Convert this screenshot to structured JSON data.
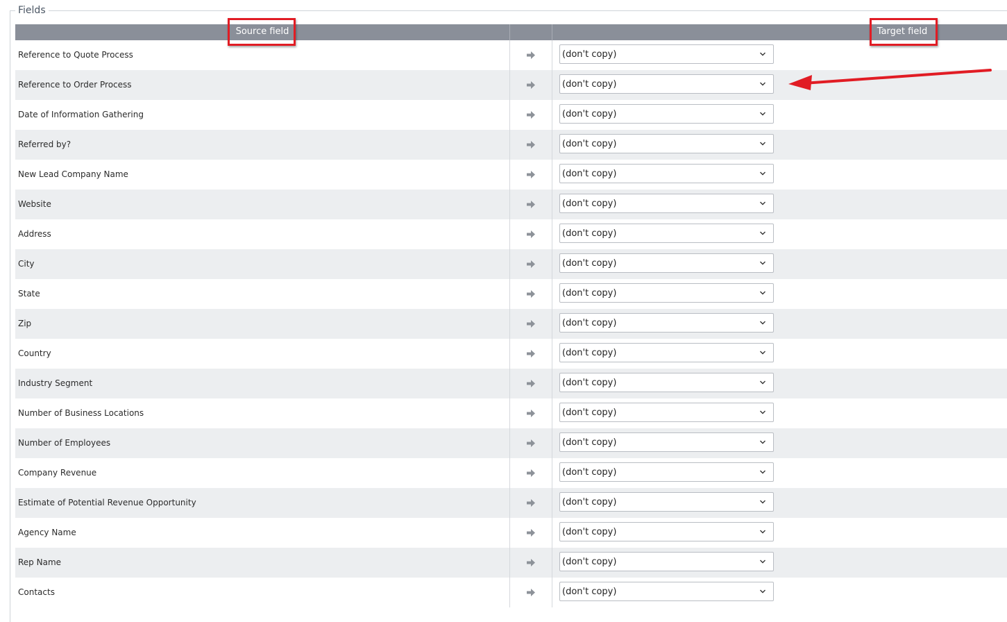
{
  "section": {
    "legend": "Fields"
  },
  "table": {
    "source_header": "Source field",
    "target_header": "Target field",
    "rows": [
      {
        "source": "Reference to Quote Process",
        "target": "(don't copy)"
      },
      {
        "source": "Reference to Order Process",
        "target": "(don't copy)"
      },
      {
        "source": "Date of Information Gathering",
        "target": "(don't copy)"
      },
      {
        "source": "Referred by?",
        "target": "(don't copy)"
      },
      {
        "source": "New Lead Company Name",
        "target": "(don't copy)"
      },
      {
        "source": "Website",
        "target": "(don't copy)"
      },
      {
        "source": "Address",
        "target": "(don't copy)"
      },
      {
        "source": "City",
        "target": "(don't copy)"
      },
      {
        "source": "State",
        "target": "(don't copy)"
      },
      {
        "source": "Zip",
        "target": "(don't copy)"
      },
      {
        "source": "Country",
        "target": "(don't copy)"
      },
      {
        "source": "Industry Segment",
        "target": "(don't copy)"
      },
      {
        "source": "Number of Business Locations",
        "target": "(don't copy)"
      },
      {
        "source": "Number of Employees",
        "target": "(don't copy)"
      },
      {
        "source": "Company Revenue",
        "target": "(don't copy)"
      },
      {
        "source": "Estimate of Potential Revenue Opportunity",
        "target": "(don't copy)"
      },
      {
        "source": "Agency Name",
        "target": "(don't copy)"
      },
      {
        "source": "Rep Name",
        "target": "(don't copy)"
      },
      {
        "source": "Contacts",
        "target": "(don't copy)"
      }
    ]
  },
  "icons": {
    "row_arrow": "arrow-right-icon",
    "dropdown": "chevron-down-icon",
    "annotation": "red-pointer-arrow"
  },
  "colors": {
    "header_bg": "#8a8f99",
    "alt_row_bg": "#eceef0",
    "highlight": "#e11c24"
  }
}
